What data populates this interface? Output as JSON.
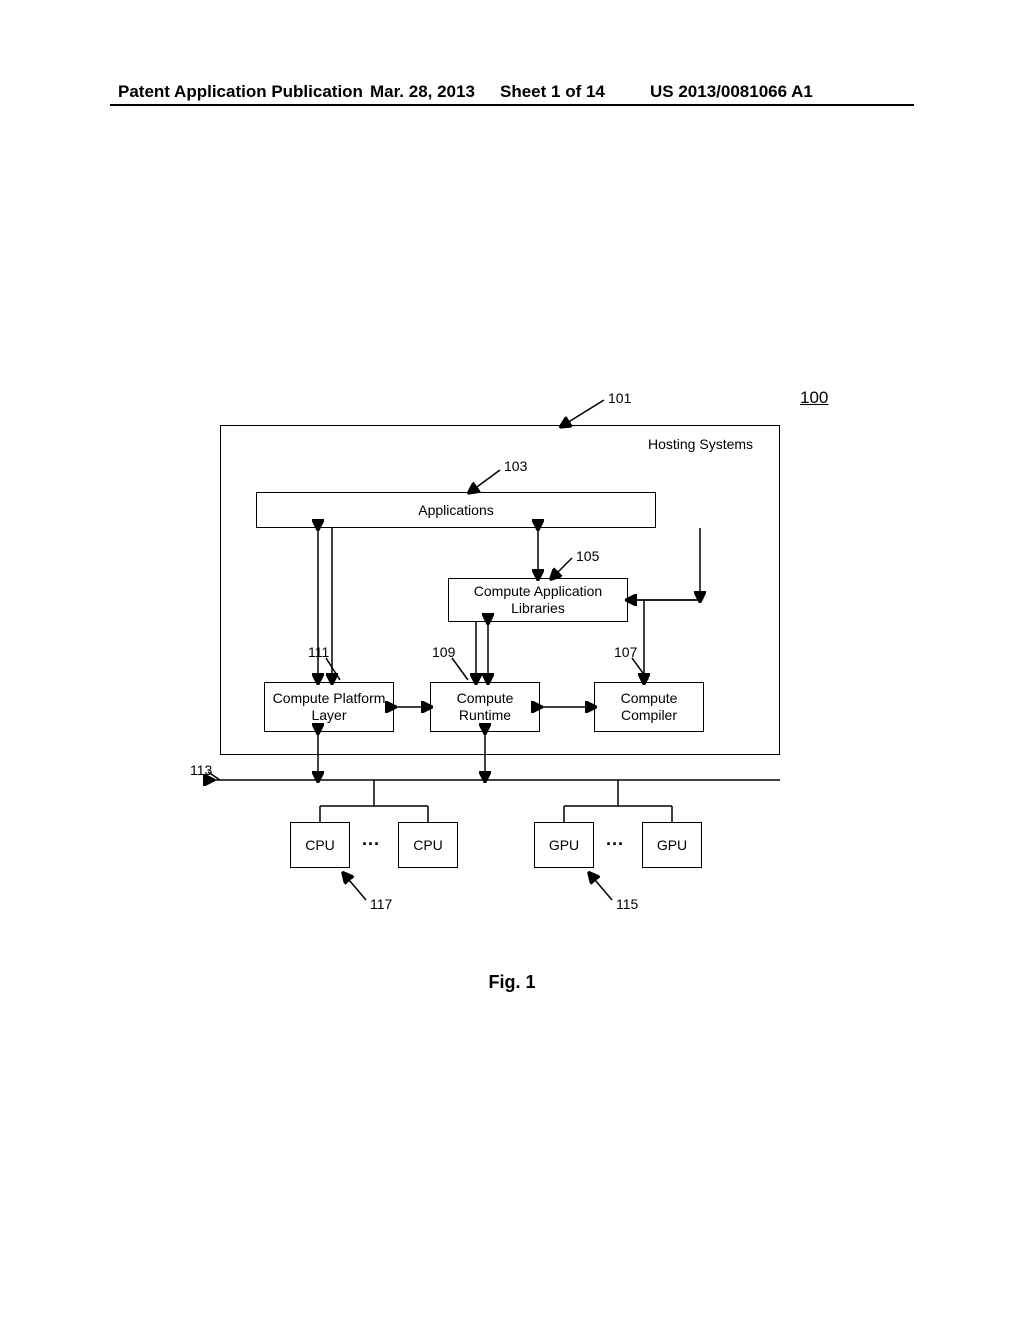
{
  "header": {
    "publication_type": "Patent Application Publication",
    "date": "Mar. 28, 2013",
    "sheet": "Sheet 1 of 14",
    "pub_number": "US 2013/0081066 A1"
  },
  "figure_label": "Fig. 1",
  "refs": {
    "r100": "100",
    "r101": "101",
    "r103": "103",
    "r105": "105",
    "r107": "107",
    "r109": "109",
    "r111": "111",
    "r113": "113",
    "r115": "115",
    "r117": "117"
  },
  "labels": {
    "hosting_systems": "Hosting Systems",
    "applications": "Applications",
    "compute_app_libs": "Compute Application Libraries",
    "compute_platform_layer": "Compute Platform Layer",
    "compute_runtime": "Compute Runtime",
    "compute_compiler": "Compute Compiler",
    "cpu": "CPU",
    "gpu": "GPU",
    "ellipsis": "···"
  }
}
